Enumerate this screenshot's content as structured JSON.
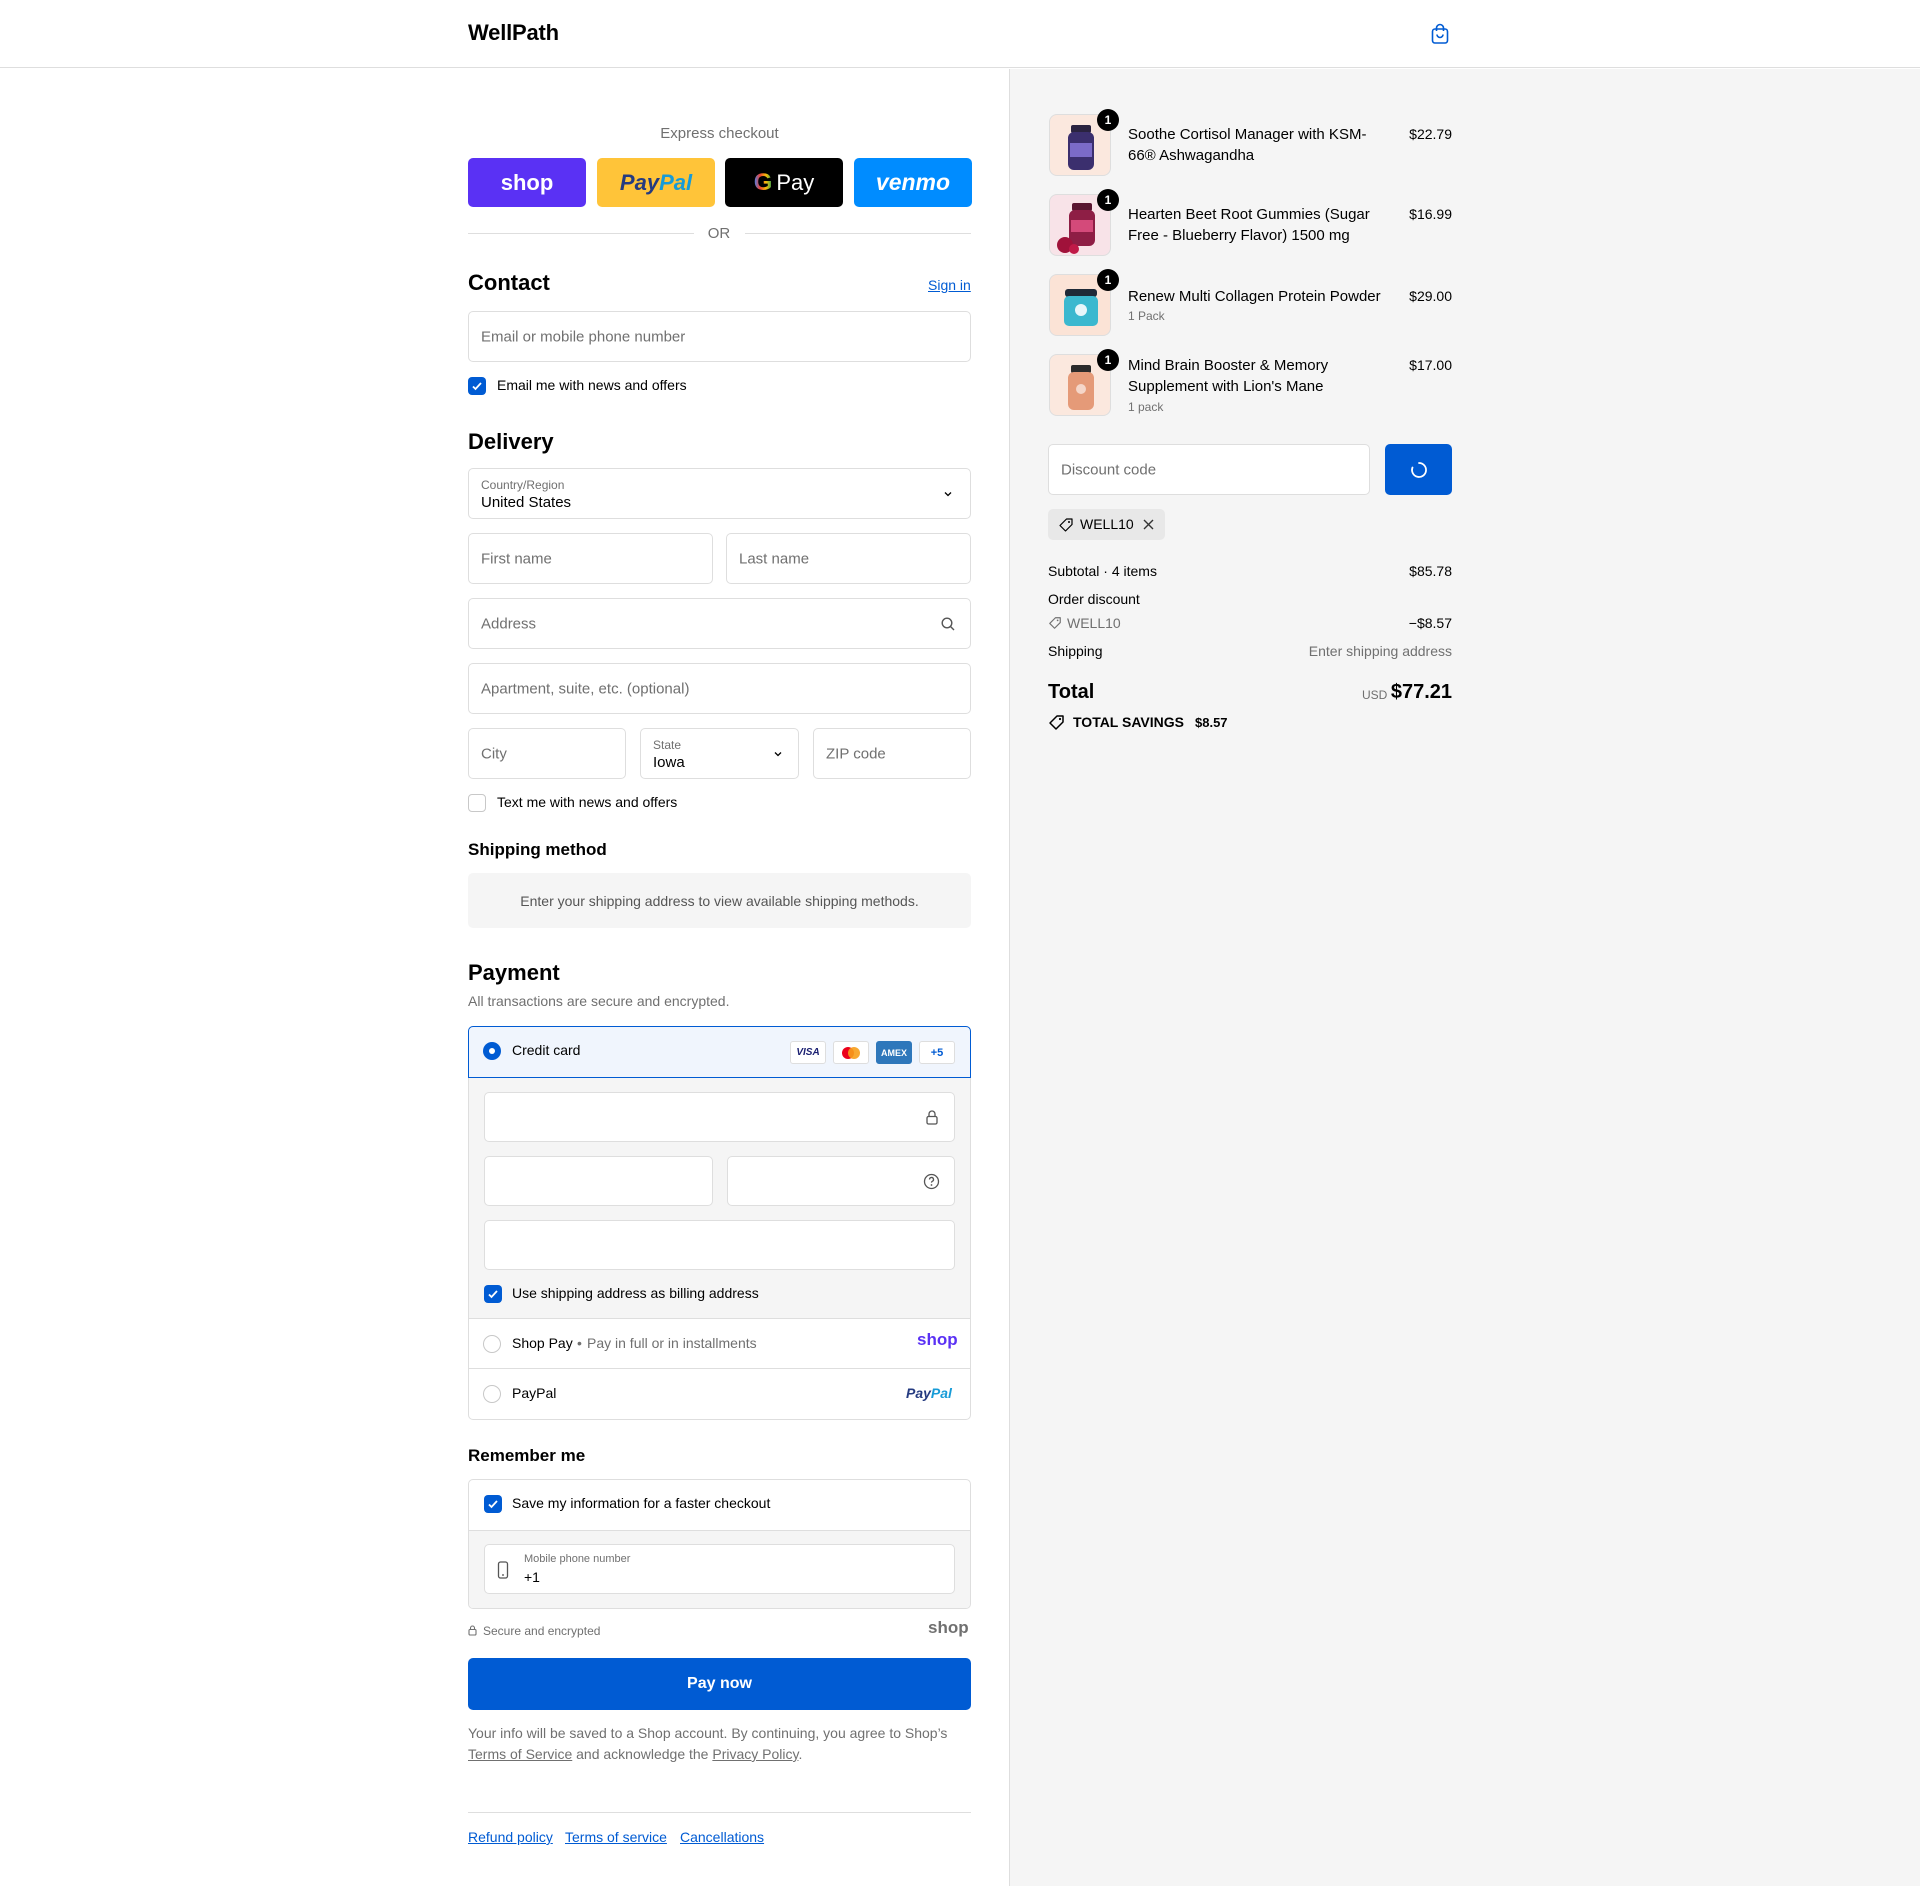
{
  "header": {
    "logo": "WellPath"
  },
  "express": {
    "title": "Express checkout",
    "or": "OR",
    "buttons": [
      {
        "label": "shop",
        "color": "#5a31f4"
      },
      {
        "label": "PayPal",
        "color": "#ffc439"
      },
      {
        "label": "G Pay",
        "color": "#000000"
      },
      {
        "label": "venmo",
        "color": "#008cff"
      }
    ]
  },
  "contact": {
    "title": "Contact",
    "sign_in": "Sign in",
    "email_placeholder": "Email or mobile phone number",
    "email_offers": "Email me with news and offers",
    "email_offers_checked": true
  },
  "delivery": {
    "title": "Delivery",
    "country_label": "Country/Region",
    "country_value": "United States",
    "first_name": "First name",
    "last_name": "Last name",
    "address": "Address",
    "apartment": "Apartment, suite, etc. (optional)",
    "city": "City",
    "state_label": "State",
    "state_value": "Iowa",
    "zip": "ZIP code",
    "text_offers": "Text me with news and offers",
    "text_offers_checked": false
  },
  "shipping_method": {
    "title": "Shipping method",
    "message": "Enter your shipping address to view available shipping methods."
  },
  "payment": {
    "title": "Payment",
    "subtitle": "All transactions are secure and encrypted.",
    "credit_card": "Credit card",
    "card_logos": [
      "VISA",
      "MC",
      "AMEX",
      "+5"
    ],
    "billing_same": "Use shipping address as billing address",
    "billing_checked": true,
    "shop_pay": "Shop Pay",
    "shop_pay_sub": "Pay in full or in installments",
    "shop_pay_logo": "shop",
    "paypal": "PayPal",
    "paypal_logo": "PayPal"
  },
  "remember": {
    "title": "Remember me",
    "save_info": "Save my information for a faster checkout",
    "save_checked": true,
    "phone_label": "Mobile phone number",
    "phone_value": "+1",
    "secure": "Secure and encrypted",
    "shop_logo": "shop"
  },
  "pay_now": "Pay now",
  "legal": {
    "text1": "Your info will be saved to a Shop account. By continuing, you agree to Shop’s",
    "terms": "Terms of Service",
    "text2": "and acknowledge the",
    "privacy": "Privacy Policy",
    "period": "."
  },
  "footer_links": [
    "Refund policy",
    "Terms of service",
    "Cancellations"
  ],
  "order": {
    "items": [
      {
        "name": "Soothe Cortisol Manager with KSM-66® Ashwagandha",
        "sub": "",
        "qty": "1",
        "price": "$22.79"
      },
      {
        "name": "Hearten Beet Root Gummies (Sugar Free - Blueberry Flavor) 1500 mg",
        "sub": "",
        "qty": "1",
        "price": "$16.99"
      },
      {
        "name": "Renew Multi Collagen Protein Powder",
        "sub": "1 Pack",
        "qty": "1",
        "price": "$29.00"
      },
      {
        "name": "Mind Brain Booster & Memory Supplement with Lion's Mane",
        "sub": "1 pack",
        "qty": "1",
        "price": "$17.00"
      }
    ],
    "discount_placeholder": "Discount code",
    "applied_code": "WELL10",
    "subtotal_label": "Subtotal · 4 items",
    "subtotal": "$85.78",
    "order_discount_label": "Order discount",
    "discount_code": "WELL10",
    "discount_amount": "−$8.57",
    "shipping_label": "Shipping",
    "shipping_value": "Enter shipping address",
    "total_label": "Total",
    "currency": "USD",
    "total": "$77.21",
    "savings_label": "TOTAL SAVINGS",
    "savings": "$8.57"
  },
  "colors": {
    "accent": "#005bd3",
    "border": "#dedede",
    "muted": "#707070",
    "sidebar_bg": "#f5f5f5"
  }
}
